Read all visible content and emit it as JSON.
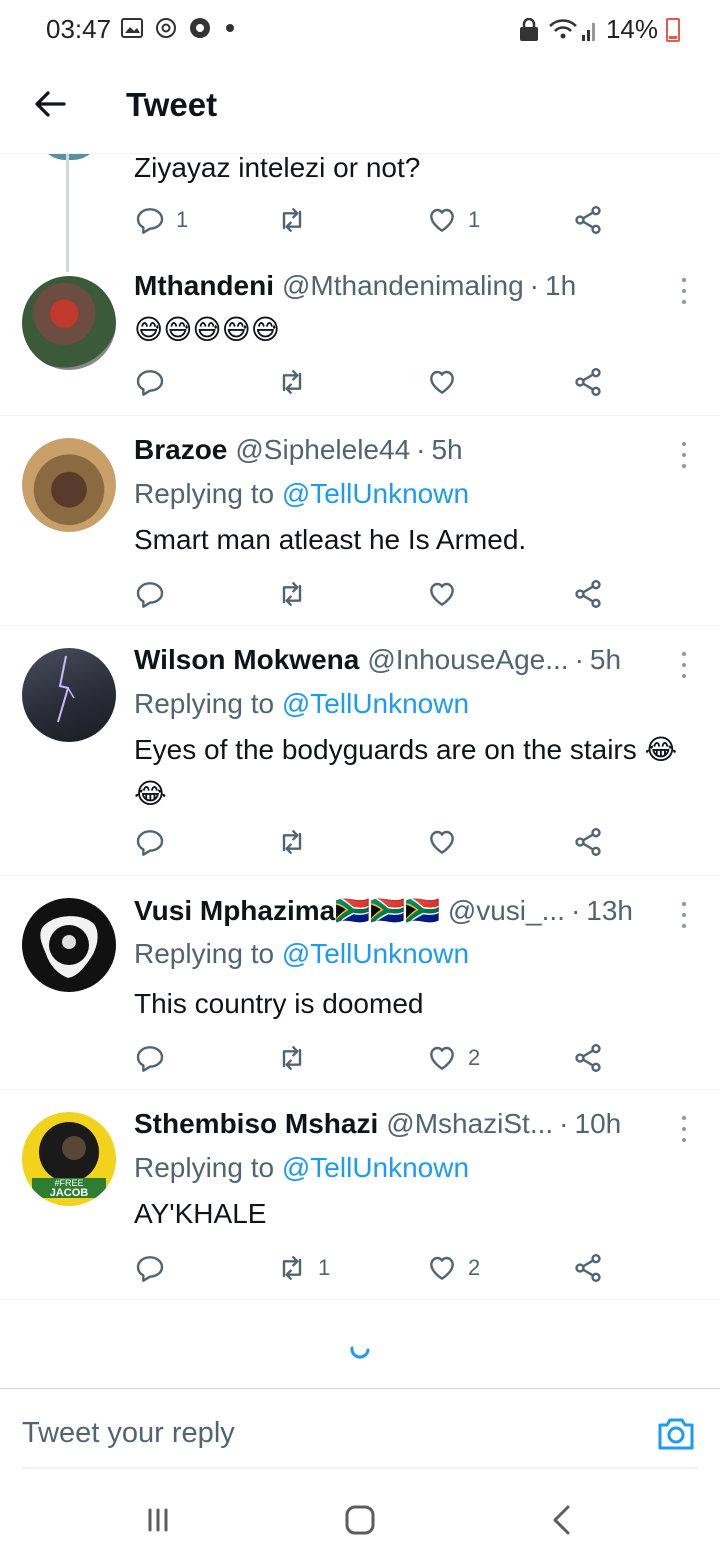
{
  "status_bar": {
    "time": "03:47",
    "battery": "14%"
  },
  "header": {
    "title": "Tweet"
  },
  "previous_tweet": {
    "text": "Ziyayaz intelezi or not?",
    "replies": "1",
    "likes": "1"
  },
  "tweets": [
    {
      "name": "Mthandeni",
      "handle": "@Mthandenimaling",
      "time": "1h",
      "text": "😅😅😅😅😅",
      "replies": "",
      "retweets": "",
      "likes": ""
    },
    {
      "name": "Brazoe",
      "handle": "@Siphelele44",
      "time": "5h",
      "reply_prefix": "Replying to ",
      "reply_to": "@TellUnknown",
      "text": "Smart man atleast he Is Armed.",
      "replies": "",
      "retweets": "",
      "likes": ""
    },
    {
      "name": "Wilson Mokwena",
      "handle": "@InhouseAge...",
      "time": "5h",
      "reply_prefix": "Replying to ",
      "reply_to": "@TellUnknown",
      "text": "Eyes of the bodyguards are on the stairs 😂 😂",
      "replies": "",
      "retweets": "",
      "likes": ""
    },
    {
      "name": "Vusi Mphazima🇿🇦🇿🇦🇿🇦",
      "handle": "@vusi_...",
      "time": "13h",
      "reply_prefix": "Replying to ",
      "reply_to": "@TellUnknown",
      "text": "This country is doomed",
      "replies": "",
      "retweets": "",
      "likes": "2"
    },
    {
      "name": "Sthembiso Mshazi",
      "handle": "@MshaziSt...",
      "time": "10h",
      "reply_prefix": "Replying to ",
      "reply_to": "@TellUnknown",
      "text": "AY'KHALE",
      "replies": "",
      "retweets": "1",
      "likes": "2",
      "avatar_badge_top": "#FREE",
      "avatar_badge_bottom": "JACOB"
    }
  ],
  "reply_bar": {
    "placeholder": "Tweet your reply"
  },
  "colors": {
    "accent": "#1d9bf0",
    "secondary_text": "#536471",
    "divider": "#eff3f4"
  },
  "icons": [
    "back-arrow-icon",
    "reply-icon",
    "retweet-icon",
    "like-icon",
    "share-icon",
    "more-icon",
    "camera-icon",
    "recent-apps-icon",
    "home-icon",
    "back-icon"
  ]
}
